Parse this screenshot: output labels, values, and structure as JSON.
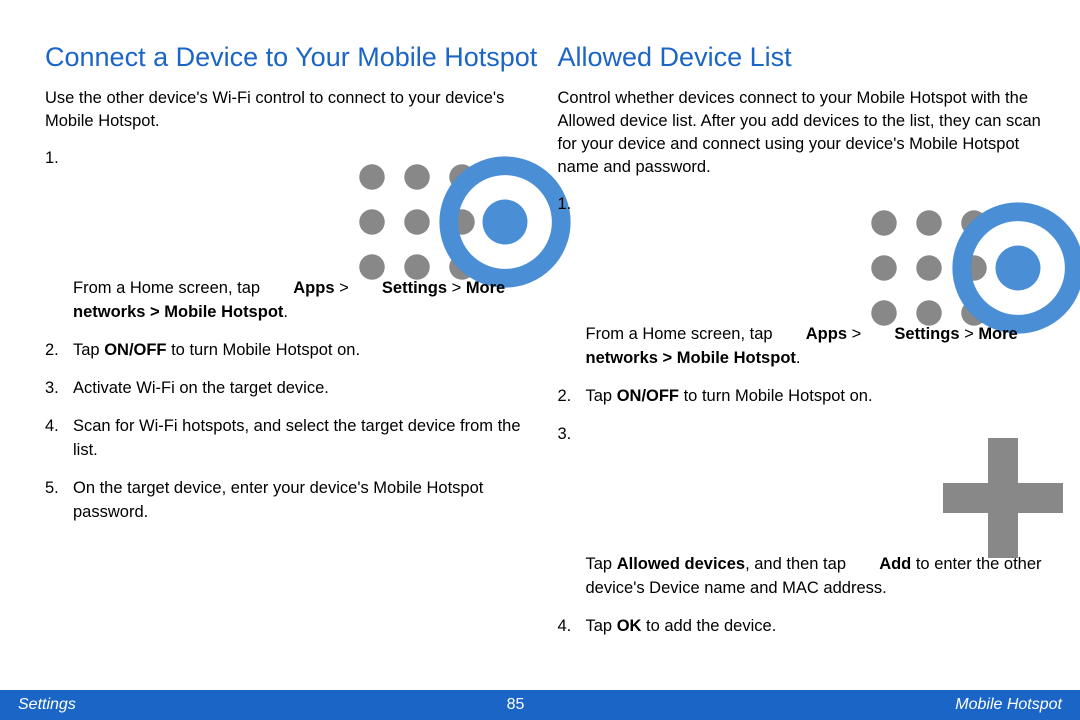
{
  "left": {
    "heading": "Connect a Device to Your Mobile Hotspot",
    "intro": "Use the other device's Wi-Fi control to connect to your device's Mobile Hotspot.",
    "steps": {
      "s1_a": "From a Home screen, tap ",
      "s1_apps": "Apps",
      "s1_gt1": " > ",
      "s1_settings": "Settings",
      "s1_gt2": " > ",
      "s1_more": "More networks > Mobile Hotspot",
      "s1_period": ".",
      "s2_a": "Tap ",
      "s2_b": "ON/OFF",
      "s2_c": " to turn Mobile Hotspot on.",
      "s3": "Activate Wi-Fi on the target device.",
      "s4": "Scan for Wi-Fi hotspots, and select the target device from the list.",
      "s5": "On the target device, enter your device's Mobile Hotspot password."
    }
  },
  "right": {
    "heading": "Allowed Device List",
    "intro": "Control whether devices connect to your Mobile Hotspot with the Allowed device list. After you add devices to the list, they can scan for your device and connect using your device's Mobile Hotspot name and password.",
    "steps": {
      "s1_a": "From a Home screen, tap ",
      "s1_apps": "Apps",
      "s1_gt1": " > ",
      "s1_settings": "Settings",
      "s1_gt2": " > ",
      "s1_more": "More networks > Mobile Hotspot",
      "s1_period": ".",
      "s2_a": "Tap ",
      "s2_b": "ON/OFF",
      "s2_c": " to turn Mobile Hotspot on.",
      "s3_a": "Tap ",
      "s3_b": "Allowed devices",
      "s3_c": ", and then tap ",
      "s3_add": "Add",
      "s3_d": " to enter the other device's Device name and MAC address.",
      "s4_a": "Tap ",
      "s4_b": "OK",
      "s4_c": " to add the device."
    }
  },
  "footer": {
    "left": "Settings",
    "center": "85",
    "right": "Mobile Hotspot"
  },
  "nums": {
    "n1": "1.",
    "n2": "2.",
    "n3": "3.",
    "n4": "4.",
    "n5": "5."
  }
}
